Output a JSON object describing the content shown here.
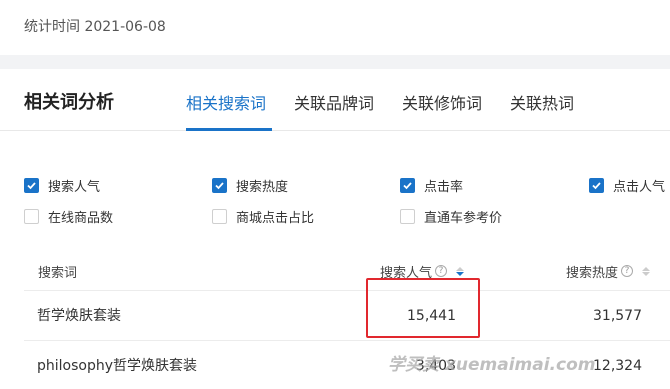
{
  "header": {
    "stat_time": "统计时间 2021-06-08"
  },
  "panel": {
    "title": "相关词分析",
    "tabs": [
      {
        "label": "相关搜索词",
        "active": true
      },
      {
        "label": "关联品牌词",
        "active": false
      },
      {
        "label": "关联修饰词",
        "active": false
      },
      {
        "label": "关联热词",
        "active": false
      }
    ]
  },
  "filters": [
    {
      "label": "搜索人气",
      "checked": true
    },
    {
      "label": "搜索热度",
      "checked": true
    },
    {
      "label": "点击率",
      "checked": true
    },
    {
      "label": "点击人气",
      "checked": true
    },
    {
      "label": "在线商品数",
      "checked": false
    },
    {
      "label": "商城点击占比",
      "checked": false
    },
    {
      "label": "直通车参考价",
      "checked": false
    }
  ],
  "table": {
    "columns": [
      {
        "label": "搜索词"
      },
      {
        "label": "搜索人气",
        "help": "?",
        "sort": "desc"
      },
      {
        "label": "搜索热度",
        "help": "?"
      }
    ],
    "rows": [
      {
        "keyword": "哲学焕肤套装",
        "popularity": "15,441",
        "heat": "31,577"
      },
      {
        "keyword": "philosophy哲学焕肤套装",
        "popularity": "3,403",
        "heat": "12,324"
      }
    ]
  },
  "colors": {
    "accent": "#1a73c8",
    "highlight": "#e1282e",
    "gap": "#f2f3f5"
  },
  "watermark": "学买卖 xuemaimai.com"
}
